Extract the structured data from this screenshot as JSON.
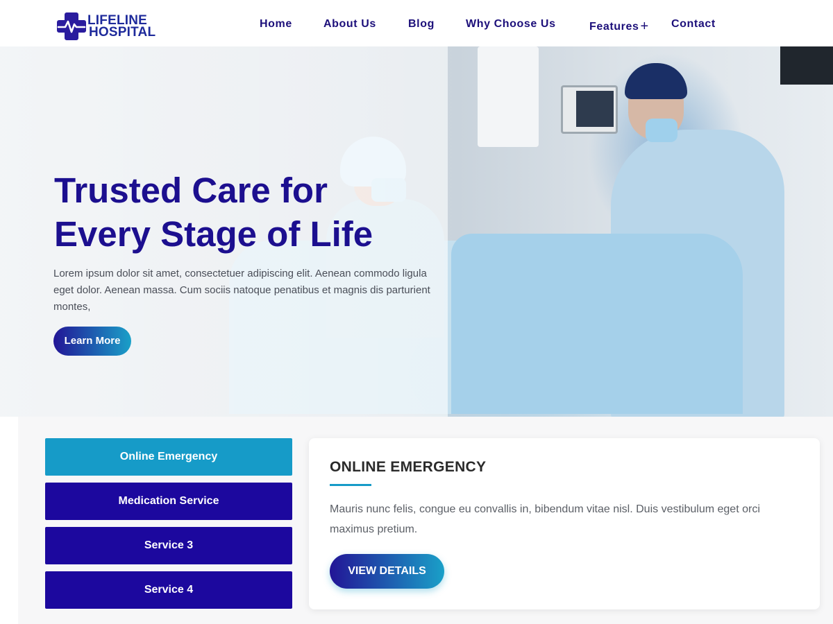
{
  "brand": {
    "line1": "LIFELINE",
    "line2": "HOSPITAL",
    "icon": "medical-cross-heartbeat-icon",
    "colors": {
      "primary": "#1e2a9b",
      "accent": "#1aa0c8"
    }
  },
  "nav": {
    "items": [
      {
        "label": "Home"
      },
      {
        "label": "About Us"
      },
      {
        "label": "Blog"
      },
      {
        "label": "Why Choose Us"
      },
      {
        "label": "Features",
        "suffix": "+"
      },
      {
        "label": "Contact"
      }
    ]
  },
  "hero": {
    "title_line1": "Trusted Care for",
    "title_line2": "Every Stage of Life",
    "description": "Lorem ipsum dolor sit amet, consectetuer adipiscing elit. Aenean commodo ligula eget dolor. Aenean massa. Cum sociis natoque penatibus et magnis dis parturient montes,",
    "cta_label": "Learn More"
  },
  "services": {
    "tabs": [
      {
        "label": "Online Emergency",
        "active": true
      },
      {
        "label": "Medication Service",
        "active": false
      },
      {
        "label": "Service 3",
        "active": false
      },
      {
        "label": "Service 4",
        "active": false
      }
    ],
    "detail": {
      "title": "ONLINE EMERGENCY",
      "description": "Mauris nunc felis, congue eu convallis in, bibendum vitae nisl. Duis vestibulum eget orci maximus pretium.",
      "button_label": "VIEW DETAILS"
    },
    "colors": {
      "active_tab": "#169bc8",
      "inactive_tab": "#1c089e"
    }
  }
}
